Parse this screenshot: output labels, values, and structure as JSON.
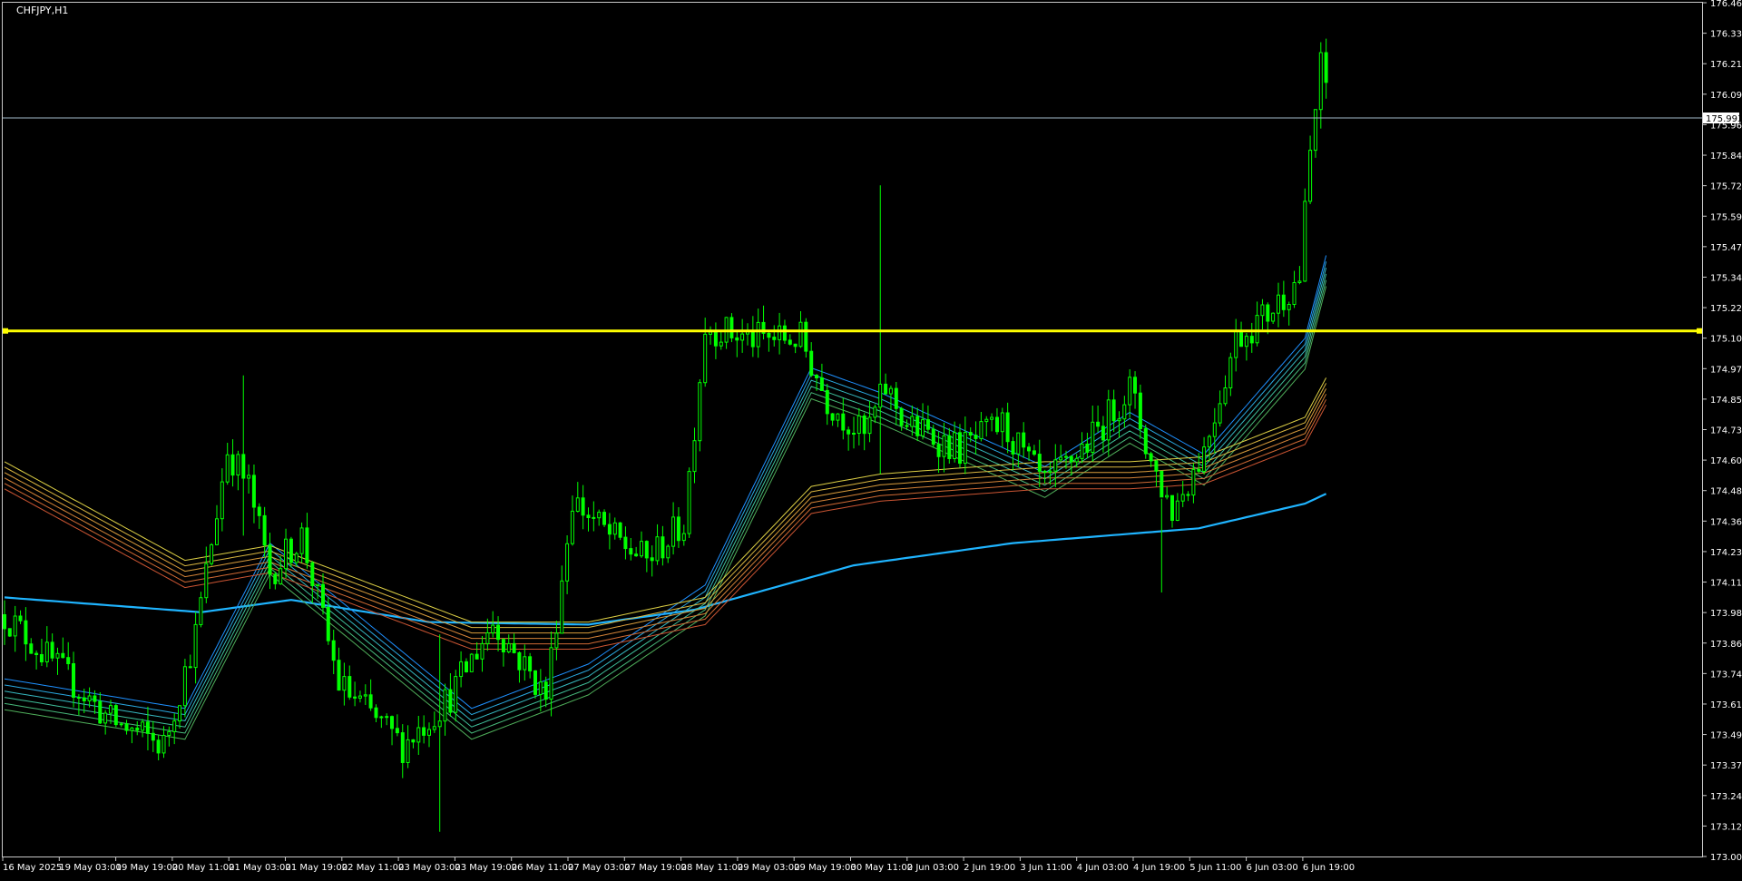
{
  "symbol_label": "CHFJPY,H1",
  "colors": {
    "background": "#000000",
    "frame": "#c8c8c8",
    "candle": "#00ff00",
    "hline": "#ffff00",
    "bid_line": "#9fb8c8",
    "long_ma": "#1fb4ff",
    "axis_text": "#ffffff",
    "ribbon_fast": [
      "#1e90ff",
      "#2aa8e0",
      "#36b8c0",
      "#3fbf9a",
      "#47b87a",
      "#4fae5a"
    ],
    "ribbon_slow": [
      "#dccf45",
      "#d9b640",
      "#d89c3c",
      "#d48338",
      "#d06a34",
      "#cc5533"
    ]
  },
  "chart_data": {
    "type": "line",
    "title": "",
    "y_ticks": [
      "176.460",
      "176.335",
      "176.215",
      "176.090",
      "175.965",
      "175.840",
      "175.720",
      "175.595",
      "175.470",
      "175.345",
      "175.225",
      "175.100",
      "174.975",
      "174.850",
      "174.730",
      "174.605",
      "174.480",
      "174.360",
      "174.235",
      "174.110",
      "173.985",
      "173.865",
      "173.740",
      "173.615",
      "173.490",
      "173.370",
      "173.245",
      "173.120",
      "173.000"
    ],
    "x_ticks": [
      "16 May 2025",
      "19 May 03:00",
      "19 May 19:00",
      "20 May 11:00",
      "21 May 03:00",
      "21 May 19:00",
      "22 May 11:00",
      "23 May 03:00",
      "23 May 19:00",
      "26 May 11:00",
      "27 May 03:00",
      "27 May 19:00",
      "28 May 11:00",
      "29 May 03:00",
      "29 May 19:00",
      "30 May 11:00",
      "2 Jun 03:00",
      "2 Jun 19:00",
      "3 Jun 11:00",
      "4 Jun 03:00",
      "4 Jun 19:00",
      "5 Jun 11:00",
      "6 Jun 03:00",
      "6 Jun 19:00"
    ],
    "ylim": [
      173.0,
      176.46
    ],
    "horizontal_line": 175.13,
    "current_price": 175.993,
    "current_price_label": "175.993",
    "close_path": [
      {
        "bar": 0,
        "price": 173.98
      },
      {
        "bar": 20,
        "price": 173.55
      },
      {
        "bar": 30,
        "price": 173.45
      },
      {
        "bar": 36,
        "price": 173.9
      },
      {
        "bar": 42,
        "price": 174.65
      },
      {
        "bar": 46,
        "price": 174.5
      },
      {
        "bar": 50,
        "price": 174.15
      },
      {
        "bar": 56,
        "price": 174.3
      },
      {
        "bar": 63,
        "price": 173.7
      },
      {
        "bar": 75,
        "price": 173.45
      },
      {
        "bar": 84,
        "price": 173.65
      },
      {
        "bar": 92,
        "price": 173.95
      },
      {
        "bar": 102,
        "price": 173.65
      },
      {
        "bar": 107,
        "price": 174.45
      },
      {
        "bar": 114,
        "price": 174.3
      },
      {
        "bar": 121,
        "price": 174.2
      },
      {
        "bar": 128,
        "price": 174.35
      },
      {
        "bar": 132,
        "price": 175.15
      },
      {
        "bar": 140,
        "price": 175.1
      },
      {
        "bar": 150,
        "price": 175.1
      },
      {
        "bar": 155,
        "price": 174.85
      },
      {
        "bar": 162,
        "price": 174.7
      },
      {
        "bar": 166,
        "price": 174.9
      },
      {
        "bar": 170,
        "price": 174.75
      },
      {
        "bar": 180,
        "price": 174.65
      },
      {
        "bar": 188,
        "price": 174.75
      },
      {
        "bar": 196,
        "price": 174.5
      },
      {
        "bar": 205,
        "price": 174.7
      },
      {
        "bar": 212,
        "price": 174.9
      },
      {
        "bar": 216,
        "price": 174.6
      },
      {
        "bar": 220,
        "price": 174.4
      },
      {
        "bar": 226,
        "price": 174.65
      },
      {
        "bar": 232,
        "price": 175.1
      },
      {
        "bar": 238,
        "price": 175.2
      },
      {
        "bar": 244,
        "price": 175.35
      },
      {
        "bar": 246,
        "price": 175.85
      },
      {
        "bar": 248,
        "price": 176.2
      },
      {
        "bar": 250,
        "price": 176.05
      }
    ],
    "spikes": [
      {
        "bar": 165,
        "high": 175.72,
        "low": 174.55
      },
      {
        "bar": 45,
        "high": 174.95,
        "low": 174.3
      },
      {
        "bar": 248,
        "high": 176.3,
        "low": 175.95
      },
      {
        "bar": 82,
        "high": 173.9,
        "low": 173.1
      },
      {
        "bar": 218,
        "high": 174.45,
        "low": 174.07
      }
    ],
    "long_ma": [
      {
        "bar": 0,
        "price": 174.05
      },
      {
        "bar": 37,
        "price": 173.99
      },
      {
        "bar": 54,
        "price": 174.04
      },
      {
        "bar": 80,
        "price": 173.95
      },
      {
        "bar": 110,
        "price": 173.94
      },
      {
        "bar": 130,
        "price": 174.0
      },
      {
        "bar": 160,
        "price": 174.18
      },
      {
        "bar": 190,
        "price": 174.27
      },
      {
        "bar": 225,
        "price": 174.33
      },
      {
        "bar": 245,
        "price": 174.43
      },
      {
        "bar": 250,
        "price": 174.48
      }
    ],
    "ribbon": [
      {
        "bar": 0,
        "fast": 173.72,
        "slow": 174.6
      },
      {
        "bar": 34,
        "fast": 173.6,
        "slow": 174.2
      },
      {
        "bar": 50,
        "fast": 174.27,
        "slow": 174.26
      },
      {
        "bar": 88,
        "fast": 173.6,
        "slow": 173.95
      },
      {
        "bar": 110,
        "fast": 173.78,
        "slow": 173.95
      },
      {
        "bar": 132,
        "fast": 174.1,
        "slow": 174.05
      },
      {
        "bar": 152,
        "fast": 174.98,
        "slow": 174.5
      },
      {
        "bar": 165,
        "fast": 174.88,
        "slow": 174.55
      },
      {
        "bar": 196,
        "fast": 174.58,
        "slow": 174.6
      },
      {
        "bar": 212,
        "fast": 174.8,
        "slow": 174.6
      },
      {
        "bar": 226,
        "fast": 174.63,
        "slow": 174.62
      },
      {
        "bar": 245,
        "fast": 175.1,
        "slow": 174.78
      },
      {
        "bar": 250,
        "fast": 175.52,
        "slow": 174.98
      }
    ]
  }
}
